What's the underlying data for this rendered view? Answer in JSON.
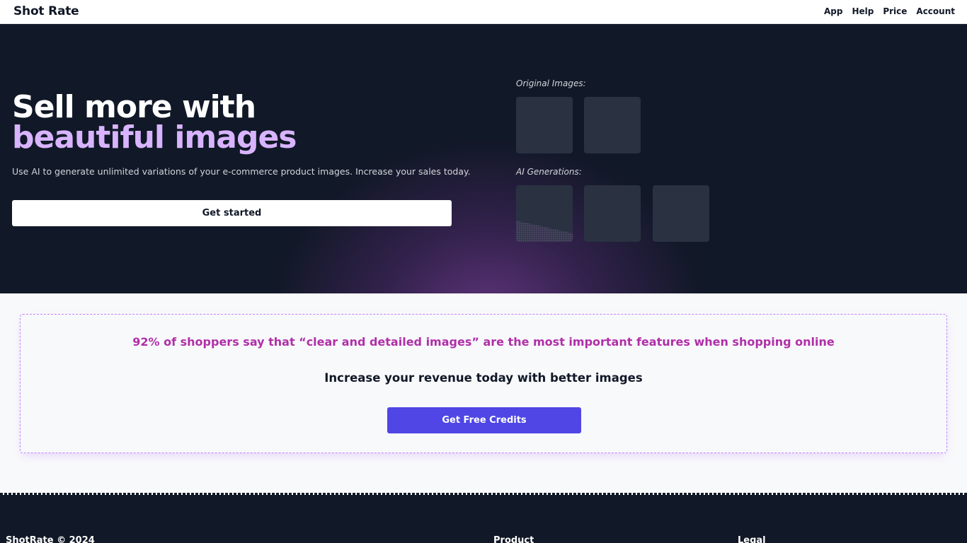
{
  "nav": {
    "brand": "Shot Rate",
    "links": [
      "App",
      "Help",
      "Price",
      "Account"
    ]
  },
  "hero": {
    "headline_line1": "Sell more with",
    "headline_line2": "beautiful images",
    "subtext": "Use AI to generate unlimited variations of your e-commerce product images. Increase your sales today.",
    "cta": "Get started",
    "original_label": "Original Images:",
    "ai_label": "AI Generations:"
  },
  "stat": {
    "quote": "92% of shoppers say that “clear and detailed images” are the most important features when shopping online",
    "subheading": "Increase your revenue today with better images",
    "cta": "Get Free Credits"
  },
  "footer": {
    "copyright": "ShotRate © 2024",
    "product_heading": "Product",
    "legal_heading": "Legal"
  },
  "colors": {
    "hero_bg": "#111827",
    "accent_purple": "#d8b4fe",
    "quote_magenta": "#b02fa8",
    "cta_indigo": "#4f46e5"
  }
}
